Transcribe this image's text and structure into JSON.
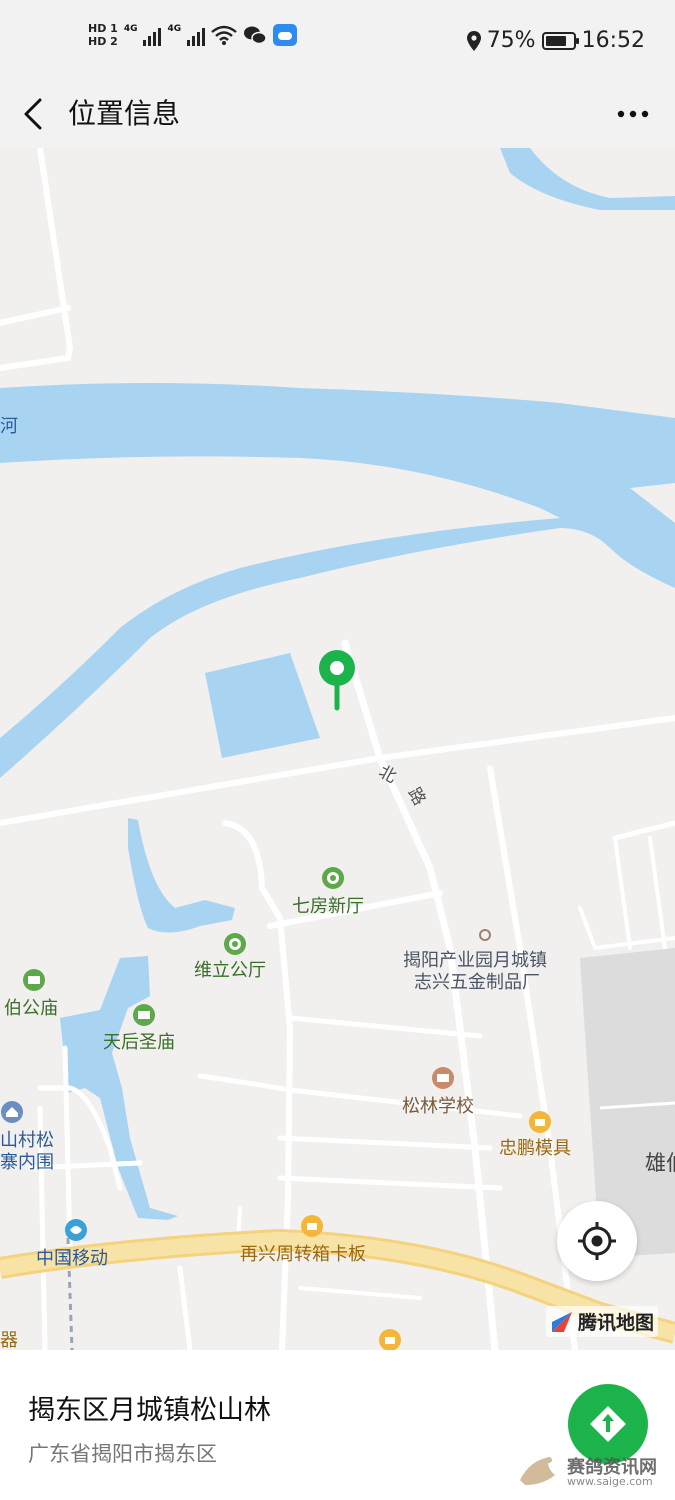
{
  "status_bar": {
    "hd1": "HD 1",
    "hd2": "HD 2",
    "net1": "4G",
    "net2": "4G",
    "battery_percent": "75%",
    "battery_level": 0.75,
    "time": "16:52"
  },
  "nav": {
    "title": "位置信息"
  },
  "map": {
    "road_label_1": "北",
    "road_label_2": "路",
    "river_label": "河",
    "pois": {
      "qifang": "七房新厅",
      "weili": "维立公厅",
      "baigong": "伯公庙",
      "tianhou": "天后圣庙",
      "jieyang_factory_line1": "揭阳产业园月城镇",
      "jieyang_factory_line2": "志兴五金制品厂",
      "songlin_school": "松林学校",
      "zhongpeng": "忠鹏模具",
      "village_line1": "山村松",
      "village_line2": "寨内围",
      "china_mobile": "中国移动",
      "zaixing": "再兴周转箱卡板",
      "xiong": "雄伯",
      "qi": "器"
    },
    "logo_text": "腾讯地图"
  },
  "place": {
    "name": "揭东区月城镇松山林",
    "address": "广东省揭阳市揭东区"
  },
  "watermark": {
    "text": "赛鸽资讯网",
    "url": "www.saige.com"
  },
  "colors": {
    "water": "#a8d4f2",
    "marker": "#1bb34a",
    "nav_button": "#1bb34a",
    "main_road": "#f8e3a6"
  }
}
